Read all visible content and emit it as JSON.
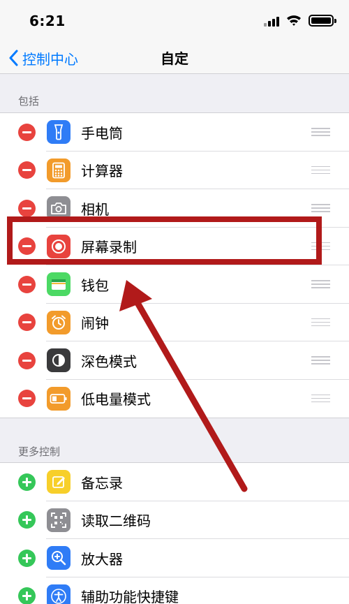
{
  "status_bar": {
    "time": "6:21"
  },
  "nav": {
    "back_label": "控制中心",
    "title": "自定"
  },
  "included": {
    "header": "包括",
    "items": [
      {
        "label": "手电筒",
        "icon": "flashlight-icon",
        "color": "#2f7cf6"
      },
      {
        "label": "计算器",
        "icon": "calculator-icon",
        "color": "#f29b2b"
      },
      {
        "label": "相机",
        "icon": "camera-icon",
        "color": "#8e8e93"
      },
      {
        "label": "屏幕录制",
        "icon": "screen-record-icon",
        "color": "#e8433e"
      },
      {
        "label": "钱包",
        "icon": "wallet-icon",
        "color": "#4cd964"
      },
      {
        "label": "闹钟",
        "icon": "alarm-icon",
        "color": "#f29b2b"
      },
      {
        "label": "深色模式",
        "icon": "dark-mode-icon",
        "color": "#3a3a3c"
      },
      {
        "label": "低电量模式",
        "icon": "low-power-icon",
        "color": "#f29b2b"
      }
    ]
  },
  "more": {
    "header": "更多控制",
    "items": [
      {
        "label": "备忘录",
        "icon": "notes-icon",
        "color": "#f7cf2a"
      },
      {
        "label": "读取二维码",
        "icon": "qr-code-icon",
        "color": "#8e8e93"
      },
      {
        "label": "放大器",
        "icon": "magnifier-icon",
        "color": "#2f7cf6"
      },
      {
        "label": "辅助功能快捷键",
        "icon": "accessibility-icon",
        "color": "#2f7cf6"
      }
    ]
  },
  "annotation_color": "#b11a1a"
}
